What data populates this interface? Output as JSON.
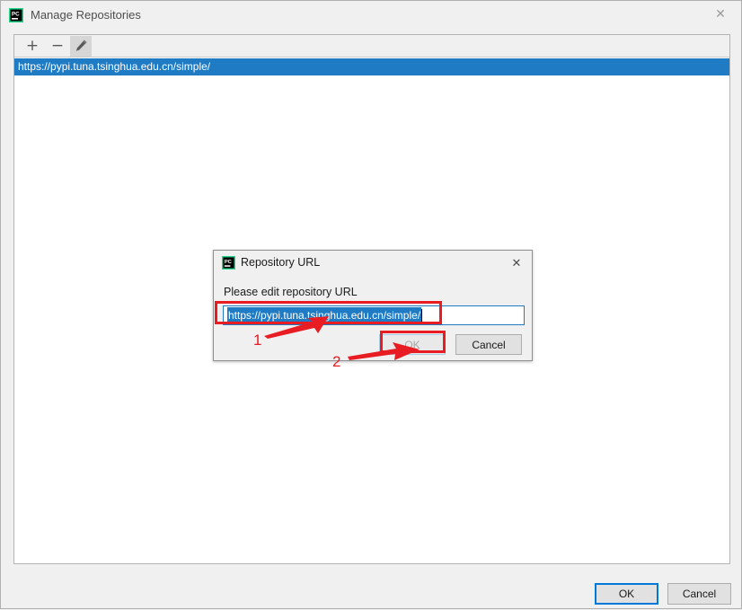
{
  "window": {
    "title": "Manage Repositories",
    "icon": "pycharm-icon",
    "close_label": "✕"
  },
  "toolbar": {
    "add_label": "+",
    "remove_label": "−",
    "edit_icon": "pencil-icon"
  },
  "repository_list": {
    "items": [
      {
        "url": "https://pypi.tuna.tsinghua.edu.cn/simple/",
        "selected": true
      }
    ]
  },
  "footer": {
    "ok_label": "OK",
    "cancel_label": "Cancel"
  },
  "dialog": {
    "icon": "pycharm-icon",
    "title": "Repository URL",
    "close_label": "✕",
    "prompt": "Please edit repository URL",
    "input": {
      "value": "https://pypi.tuna.tsinghua.edu.cn/simple/",
      "placeholder": "",
      "selected": true
    },
    "ok_label": "OK",
    "ok_enabled": false,
    "cancel_label": "Cancel"
  },
  "annotations": {
    "color": "#e81c23",
    "markers": [
      {
        "number": "1",
        "target": "repository-url-input"
      },
      {
        "number": "2",
        "target": "dialog-ok-button"
      }
    ]
  }
}
